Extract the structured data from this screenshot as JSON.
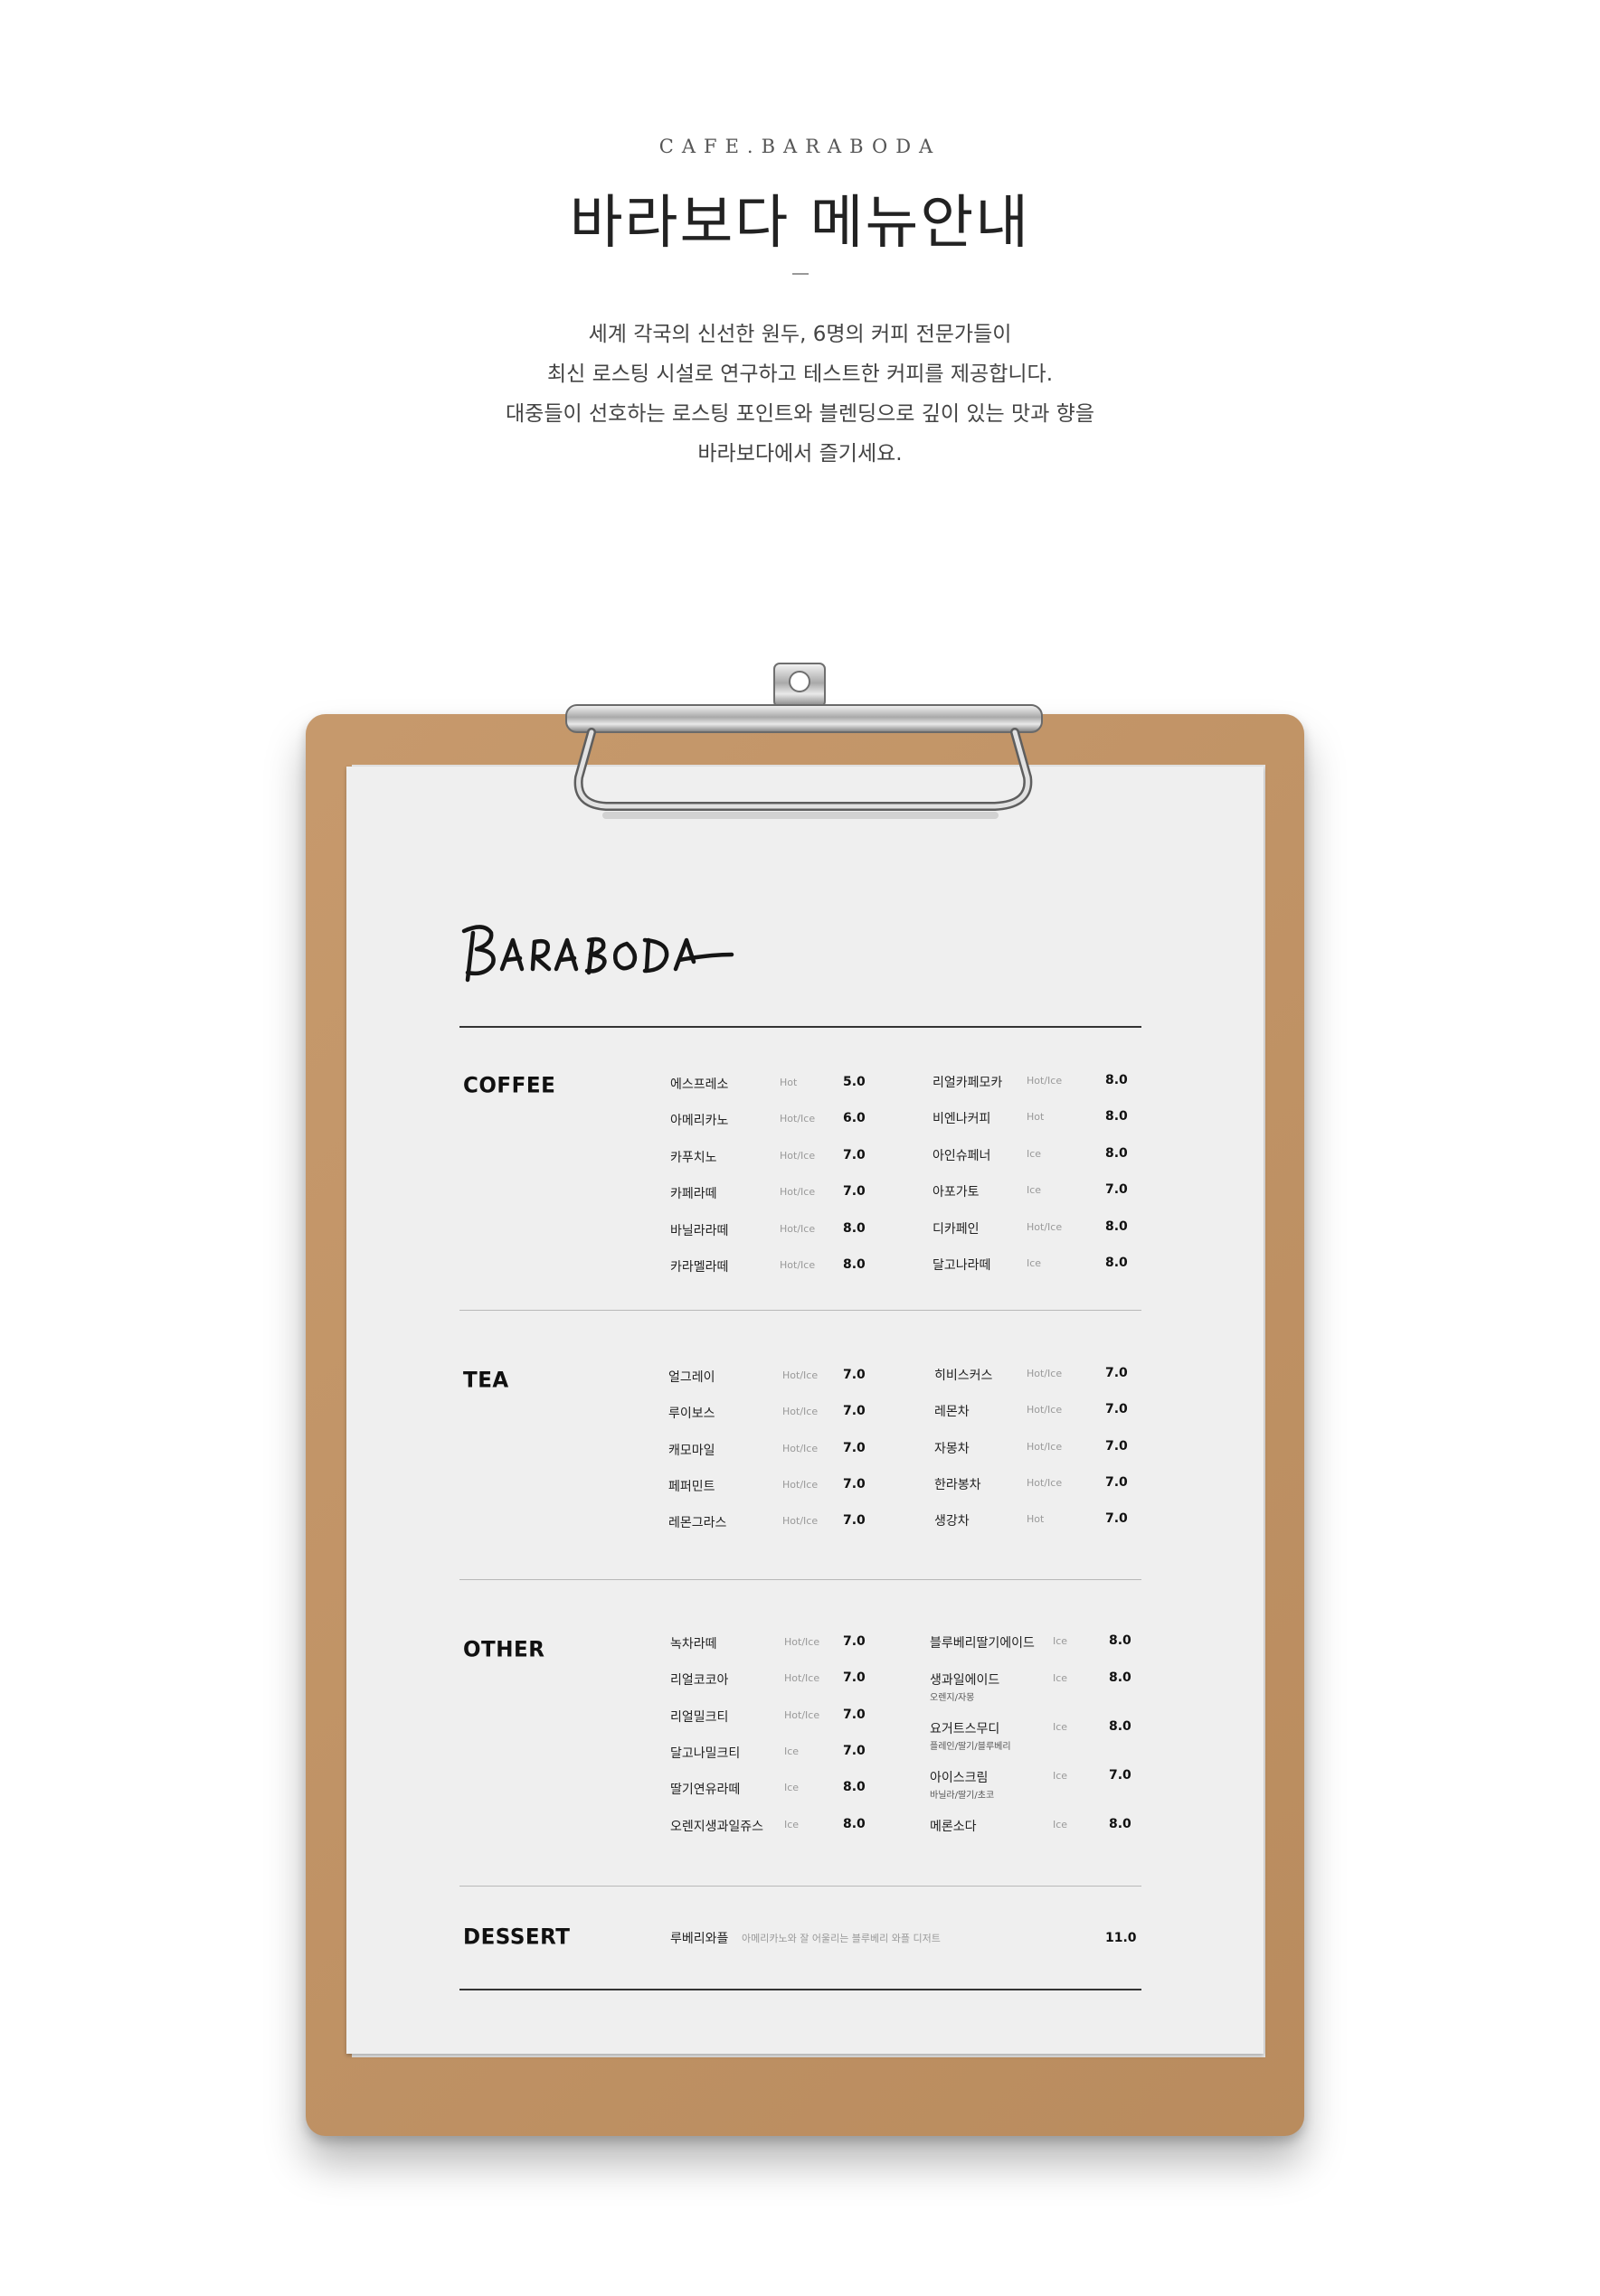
{
  "header": {
    "eyebrow": "CAFE.BARABODA",
    "title": "바라보다 메뉴안내",
    "intro": [
      "세계 각국의 신선한 원두, 6명의 커피 전문가들이",
      "최신 로스팅 시설로 연구하고 테스트한 커피를 제공합니다.",
      "대중들이 선호하는 로스팅 포인트와 블렌딩으로 깊이 있는 맛과 향을",
      "바라보다에서 즐기세요."
    ]
  },
  "menu": {
    "logo": "BARABODA",
    "categories": [
      {
        "name": "COFFEE",
        "left": [
          {
            "name": "에스프레소",
            "type": "Hot",
            "price": "5.0"
          },
          {
            "name": "아메리카노",
            "type": "Hot/Ice",
            "price": "6.0"
          },
          {
            "name": "카푸치노",
            "type": "Hot/Ice",
            "price": "7.0"
          },
          {
            "name": "카페라떼",
            "type": "Hot/Ice",
            "price": "7.0"
          },
          {
            "name": "바닐라라떼",
            "type": "Hot/Ice",
            "price": "8.0"
          },
          {
            "name": "카라멜라떼",
            "type": "Hot/Ice",
            "price": "8.0"
          }
        ],
        "right": [
          {
            "name": "리얼카페모카",
            "type": "Hot/Ice",
            "price": "8.0"
          },
          {
            "name": "비엔나커피",
            "type": "Hot",
            "price": "8.0"
          },
          {
            "name": "아인슈페너",
            "type": "Ice",
            "price": "8.0"
          },
          {
            "name": "아포가토",
            "type": "Ice",
            "price": "7.0"
          },
          {
            "name": "디카페인",
            "type": "Hot/Ice",
            "price": "8.0"
          },
          {
            "name": "달고나라떼",
            "type": "Ice",
            "price": "8.0"
          }
        ]
      },
      {
        "name": "TEA",
        "left": [
          {
            "name": "얼그레이",
            "type": "Hot/Ice",
            "price": "7.0"
          },
          {
            "name": "루이보스",
            "type": "Hot/Ice",
            "price": "7.0"
          },
          {
            "name": "캐모마일",
            "type": "Hot/Ice",
            "price": "7.0"
          },
          {
            "name": "페퍼민트",
            "type": "Hot/Ice",
            "price": "7.0"
          },
          {
            "name": "레몬그라스",
            "type": "Hot/Ice",
            "price": "7.0"
          }
        ],
        "right": [
          {
            "name": "히비스커스",
            "type": "Hot/Ice",
            "price": "7.0"
          },
          {
            "name": "레몬차",
            "type": "Hot/Ice",
            "price": "7.0"
          },
          {
            "name": "자몽차",
            "type": "Hot/Ice",
            "price": "7.0"
          },
          {
            "name": "한라봉차",
            "type": "Hot/Ice",
            "price": "7.0"
          },
          {
            "name": "생강차",
            "type": "Hot",
            "price": "7.0"
          }
        ]
      },
      {
        "name": "OTHER",
        "left": [
          {
            "name": "녹차라떼",
            "type": "Hot/Ice",
            "price": "7.0"
          },
          {
            "name": "리얼코코아",
            "type": "Hot/Ice",
            "price": "7.0"
          },
          {
            "name": "리얼밀크티",
            "type": "Hot/Ice",
            "price": "7.0"
          },
          {
            "name": "달고나밀크티",
            "type": "Ice",
            "price": "7.0"
          },
          {
            "name": "딸기연유라떼",
            "type": "Ice",
            "price": "8.0"
          },
          {
            "name": "오렌지생과일쥬스",
            "type": "Ice",
            "price": "8.0"
          }
        ],
        "right": [
          {
            "name": "블루베리딸기에이드",
            "type": "Ice",
            "price": "8.0"
          },
          {
            "name": "생과일에이드",
            "sub": "오렌지/자몽",
            "type": "Ice",
            "price": "8.0"
          },
          {
            "name": "요거트스무디",
            "sub": "플레인/딸기/블루베리",
            "type": "Ice",
            "price": "8.0"
          },
          {
            "name": "아이스크림",
            "sub": "바닐라/딸기/초코",
            "type": "Ice",
            "price": "7.0"
          },
          {
            "name": "메론소다",
            "type": "Ice",
            "price": "8.0"
          }
        ]
      },
      {
        "name": "DESSERT",
        "item": {
          "name": "루베리와플",
          "desc": "아메리카노와 잘 어울리는 블루베리 와플 디저트",
          "price": "11.0"
        }
      }
    ]
  },
  "colors": {
    "clipboard": "#c39363",
    "paper": "#efefef",
    "ink": "#111111",
    "muted": "#999999"
  }
}
